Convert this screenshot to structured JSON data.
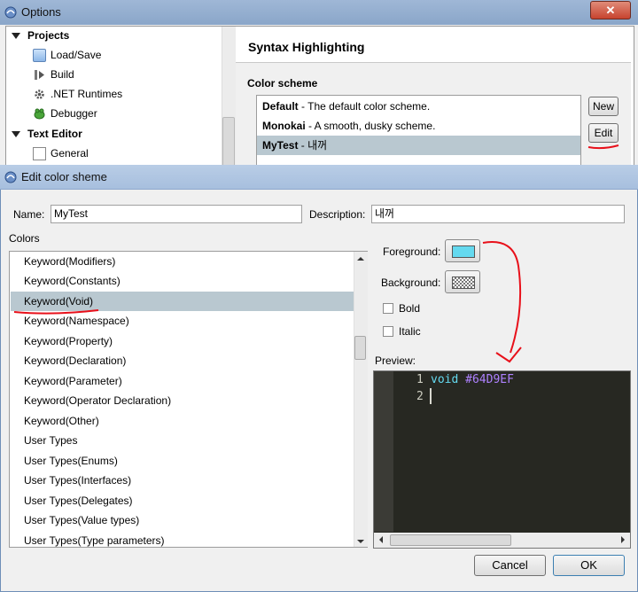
{
  "options_window": {
    "title": "Options",
    "close_glyph": "✕",
    "tree": [
      {
        "label": "Projects",
        "icon": "triangle-expand-icon",
        "level": 0
      },
      {
        "label": "Load/Save",
        "icon": "load-save-icon",
        "level": 1
      },
      {
        "label": "Build",
        "icon": "build-icon",
        "level": 1
      },
      {
        "label": ".NET Runtimes",
        "icon": "gear-icon",
        "level": 1
      },
      {
        "label": "Debugger",
        "icon": "bug-icon",
        "level": 1
      },
      {
        "label": "Text Editor",
        "icon": "triangle-expand-icon",
        "level": 0
      },
      {
        "label": "General",
        "icon": "general-icon",
        "level": 1
      }
    ],
    "panel_title": "Syntax Highlighting",
    "color_scheme_label": "Color scheme",
    "schemes": [
      {
        "name": "Default",
        "desc": " - The default color scheme."
      },
      {
        "name": "Monokai",
        "desc": " - A smooth, dusky scheme."
      },
      {
        "name": "MyTest",
        "desc": " - 내꺼"
      }
    ],
    "selected_scheme": "MyTest",
    "new_button": "New",
    "edit_button": "Edit"
  },
  "edit_dialog": {
    "title": "Edit color sheme",
    "name_label": "Name:",
    "name_value": "MyTest",
    "description_label": "Description:",
    "description_value": "내꺼",
    "colors_label": "Colors",
    "color_items": [
      "Keyword(Modifiers)",
      "Keyword(Constants)",
      "Keyword(Void)",
      "Keyword(Namespace)",
      "Keyword(Property)",
      "Keyword(Declaration)",
      "Keyword(Parameter)",
      "Keyword(Operator Declaration)",
      "Keyword(Other)",
      "User Types",
      "User Types(Enums)",
      "User Types(Interfaces)",
      "User Types(Delegates)",
      "User Types(Value types)",
      "User Types(Type parameters)"
    ],
    "selected_color_item": "Keyword(Void)",
    "foreground_label": "Foreground:",
    "background_label": "Background:",
    "bold_label": "Bold",
    "italic_label": "Italic",
    "bold_checked": false,
    "italic_checked": false,
    "preview_label": "Preview:",
    "preview_lines": [
      {
        "num": "1",
        "keyword": "void",
        "rest": " #64D9EF"
      },
      {
        "num": "2",
        "keyword": "",
        "rest": ""
      }
    ],
    "cancel_button": "Cancel",
    "ok_button": "OK"
  },
  "colors": {
    "foreground_swatch": "#64D9EF",
    "selection_bg": "#B9C8D0",
    "preview_bg": "#272822",
    "keyword_color": "#64D9EF",
    "number_color": "#AE81FF",
    "annotation_red": "#E8101A"
  }
}
